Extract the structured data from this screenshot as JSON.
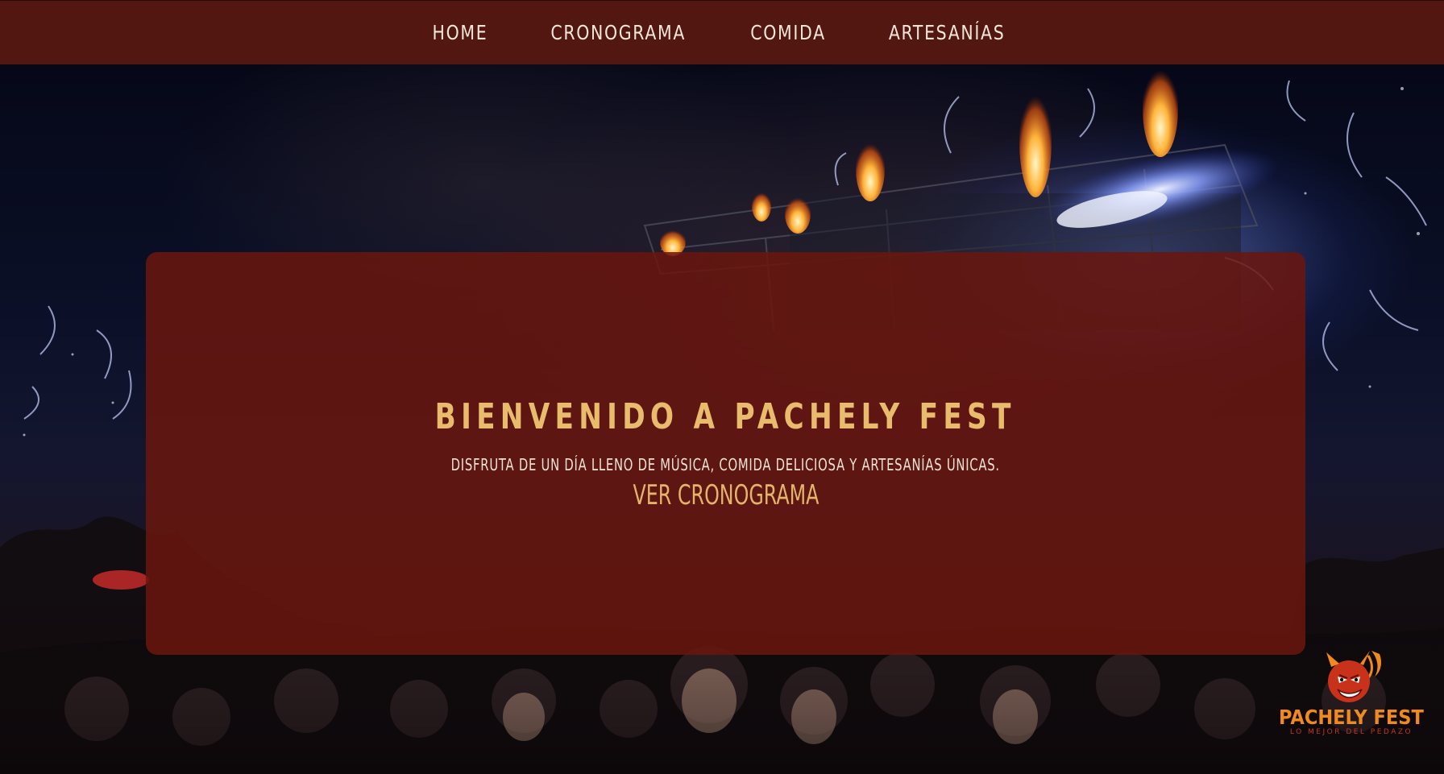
{
  "nav": {
    "items": [
      {
        "label": "HOME"
      },
      {
        "label": "CRONOGRAMA"
      },
      {
        "label": "COMIDA"
      },
      {
        "label": "ARTESANÍAS"
      }
    ]
  },
  "hero": {
    "title": "BIENVENIDO A PACHELY FEST",
    "subtitle": "DISFRUTA DE UN DÍA LLENO DE MÚSICA, COMIDA DELICIOSA Y ARTESANÍAS ÚNICAS.",
    "cta_label": "VER CRONOGRAMA",
    "background_image": "concert-crowd-stage-fire-photo"
  },
  "logo": {
    "name": "PACHELY FEST",
    "tagline": "LO MEJOR DEL PEDAZO",
    "icon": "devil-mascot-icon"
  },
  "colors": {
    "nav_background": "#521710",
    "card_background": "#6a160e",
    "title_gold": "#e9bb6d",
    "nav_text": "#f3e6d8",
    "logo_orange": "#f08a1e"
  }
}
